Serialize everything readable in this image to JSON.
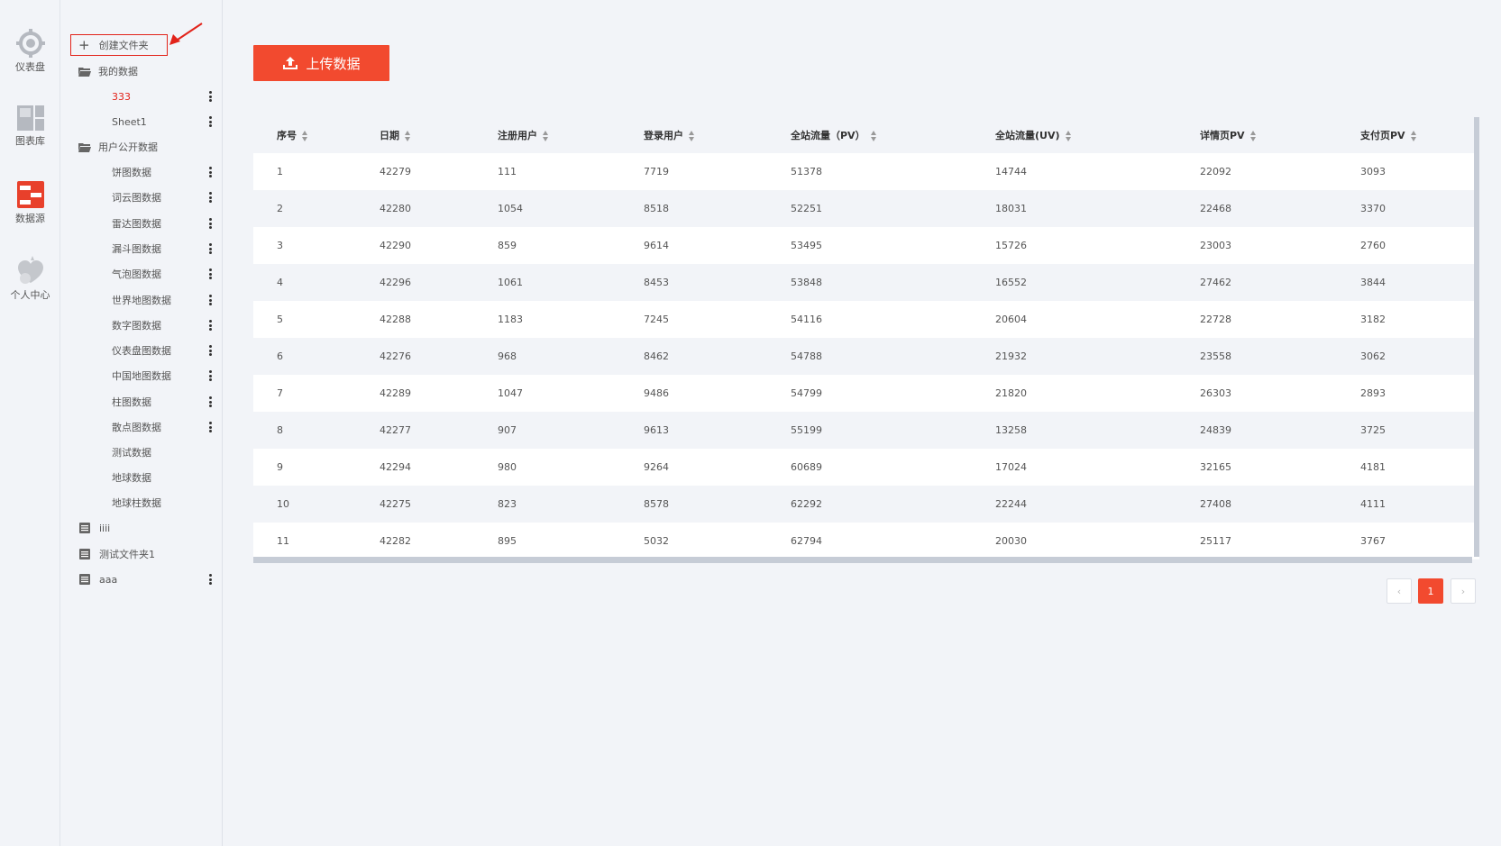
{
  "rail": {
    "items": [
      {
        "label": "仪表盘",
        "icon": "gauge-icon"
      },
      {
        "label": "图表库",
        "icon": "chart-library-icon"
      },
      {
        "label": "数据源",
        "icon": "data-source-icon"
      },
      {
        "label": "个人中心",
        "icon": "user-center-icon"
      }
    ]
  },
  "tree": {
    "create_label": "创建文件夹",
    "my_data": {
      "label": "我的数据",
      "children": [
        "333",
        "Sheet1"
      ]
    },
    "public_data": {
      "label": "用户公开数据",
      "children": [
        "饼图数据",
        "词云图数据",
        "雷达图数据",
        "漏斗图数据",
        "气泡图数据",
        "世界地图数据",
        "数字图数据",
        "仪表盘图数据",
        "中国地图数据",
        "柱图数据",
        "散点图数据",
        "测试数据",
        "地球数据",
        "地球柱数据"
      ]
    },
    "other_folders": [
      "iiii",
      "测试文件夹1",
      "aaa"
    ]
  },
  "upload_button": "上传数据",
  "table": {
    "columns": [
      "序号",
      "日期",
      "注册用户",
      "登录用户",
      "全站流量（PV）",
      "全站流量(UV)",
      "详情页PV",
      "支付页PV"
    ],
    "rows": [
      [
        "1",
        "42279",
        "111",
        "7719",
        "51378",
        "14744",
        "22092",
        "3093"
      ],
      [
        "2",
        "42280",
        "1054",
        "8518",
        "52251",
        "18031",
        "22468",
        "3370"
      ],
      [
        "3",
        "42290",
        "859",
        "9614",
        "53495",
        "15726",
        "23003",
        "2760"
      ],
      [
        "4",
        "42296",
        "1061",
        "8453",
        "53848",
        "16552",
        "27462",
        "3844"
      ],
      [
        "5",
        "42288",
        "1183",
        "7245",
        "54116",
        "20604",
        "22728",
        "3182"
      ],
      [
        "6",
        "42276",
        "968",
        "8462",
        "54788",
        "21932",
        "23558",
        "3062"
      ],
      [
        "7",
        "42289",
        "1047",
        "9486",
        "54799",
        "21820",
        "26303",
        "2893"
      ],
      [
        "8",
        "42277",
        "907",
        "9613",
        "55199",
        "13258",
        "24839",
        "3725"
      ],
      [
        "9",
        "42294",
        "980",
        "9264",
        "60689",
        "17024",
        "32165",
        "4181"
      ],
      [
        "10",
        "42275",
        "823",
        "8578",
        "62292",
        "22244",
        "27408",
        "4111"
      ],
      [
        "11",
        "42282",
        "895",
        "5032",
        "62794",
        "20030",
        "25117",
        "3767"
      ]
    ]
  },
  "pagination": {
    "prev": "‹",
    "current": "1",
    "next": "›"
  },
  "colors": {
    "accent": "#f24a2f",
    "highlight_border": "#e2231a"
  }
}
